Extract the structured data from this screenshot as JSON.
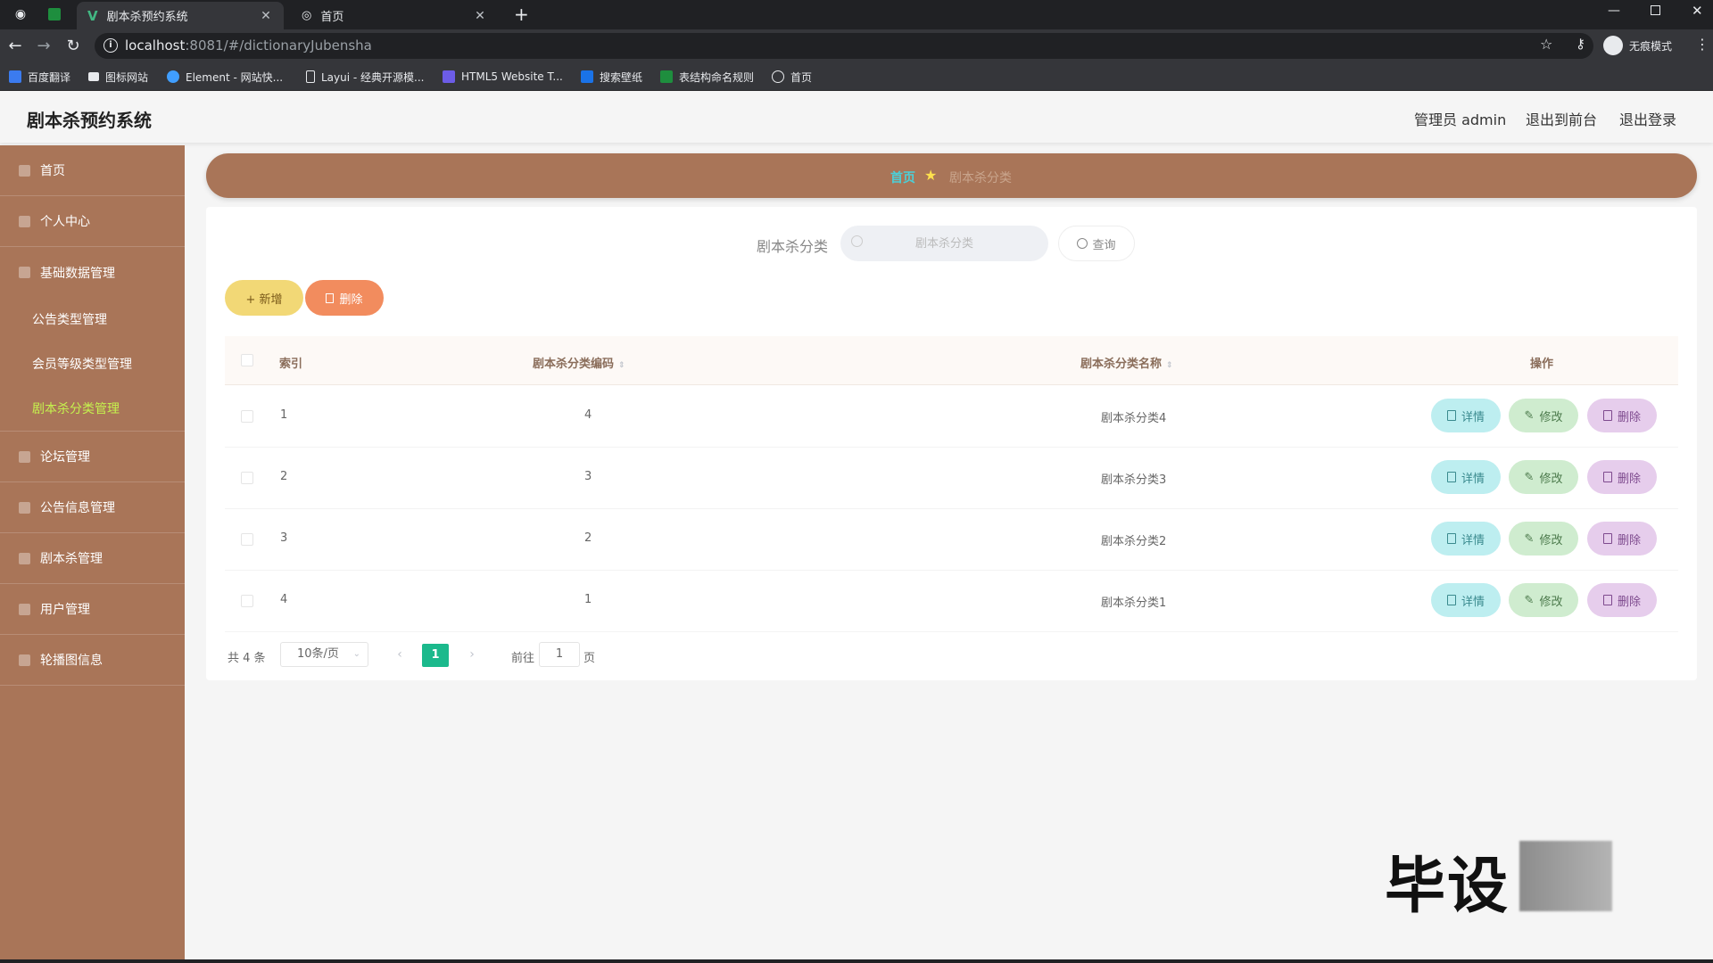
{
  "browser": {
    "tabs": [
      {
        "title": "剧本杀预约系统",
        "active": true
      },
      {
        "title": "首页",
        "active": false
      }
    ],
    "new_tab": "+",
    "url_host": "localhost",
    "url_path": ":8081/#/dictionaryJubensha",
    "profile_label": "无痕模式",
    "bookmarks": [
      "百度翻译",
      "图标网站",
      "Element - 网站快...",
      "Layui - 经典开源模...",
      "HTML5 Website T...",
      "搜索壁纸",
      "表结构命名规则",
      "首页"
    ]
  },
  "app": {
    "title": "剧本杀预约系统",
    "user_label": "管理员 admin",
    "to_front_label": "退出到前台",
    "logout_label": "退出登录"
  },
  "sidebar": {
    "items": [
      {
        "label": "首页"
      },
      {
        "label": "个人中心"
      },
      {
        "label": "基础数据管理"
      },
      {
        "label": "论坛管理"
      },
      {
        "label": "公告信息管理"
      },
      {
        "label": "剧本杀管理"
      },
      {
        "label": "用户管理"
      },
      {
        "label": "轮播图信息"
      }
    ],
    "sub_items": [
      {
        "label": "公告类型管理",
        "active": false
      },
      {
        "label": "会员等级类型管理",
        "active": false
      },
      {
        "label": "剧本杀分类管理",
        "active": true
      }
    ]
  },
  "breadcrumb": {
    "home": "首页",
    "current": "剧本杀分类"
  },
  "search": {
    "label": "剧本杀分类",
    "placeholder": "剧本杀分类",
    "query_label": "查询"
  },
  "actions": {
    "add_label": "+ 新增",
    "delete_label": "删除"
  },
  "table": {
    "columns": [
      "索引",
      "剧本杀分类编码",
      "剧本杀分类名称",
      "操作"
    ],
    "rows": [
      {
        "index": "1",
        "code": "4",
        "name": "剧本杀分类4"
      },
      {
        "index": "2",
        "code": "3",
        "name": "剧本杀分类3"
      },
      {
        "index": "3",
        "code": "2",
        "name": "剧本杀分类2"
      },
      {
        "index": "4",
        "code": "1",
        "name": "剧本杀分类1"
      }
    ],
    "row_actions": {
      "detail": "详情",
      "edit": "修改",
      "delete": "删除"
    }
  },
  "pagination": {
    "total": "共 4 条",
    "page_size": "10条/页",
    "current_page": "1",
    "goto_label": "前往",
    "goto_value": "1",
    "goto_unit": "页"
  },
  "watermark": "毕设",
  "colors": {
    "sidebar": "#a97558",
    "breadcrumb": "#a97558",
    "active_menu": "#c5f24e",
    "page_active": "#1bb98c",
    "add_btn": "#f2d876",
    "del_btn": "#f28c5e"
  }
}
